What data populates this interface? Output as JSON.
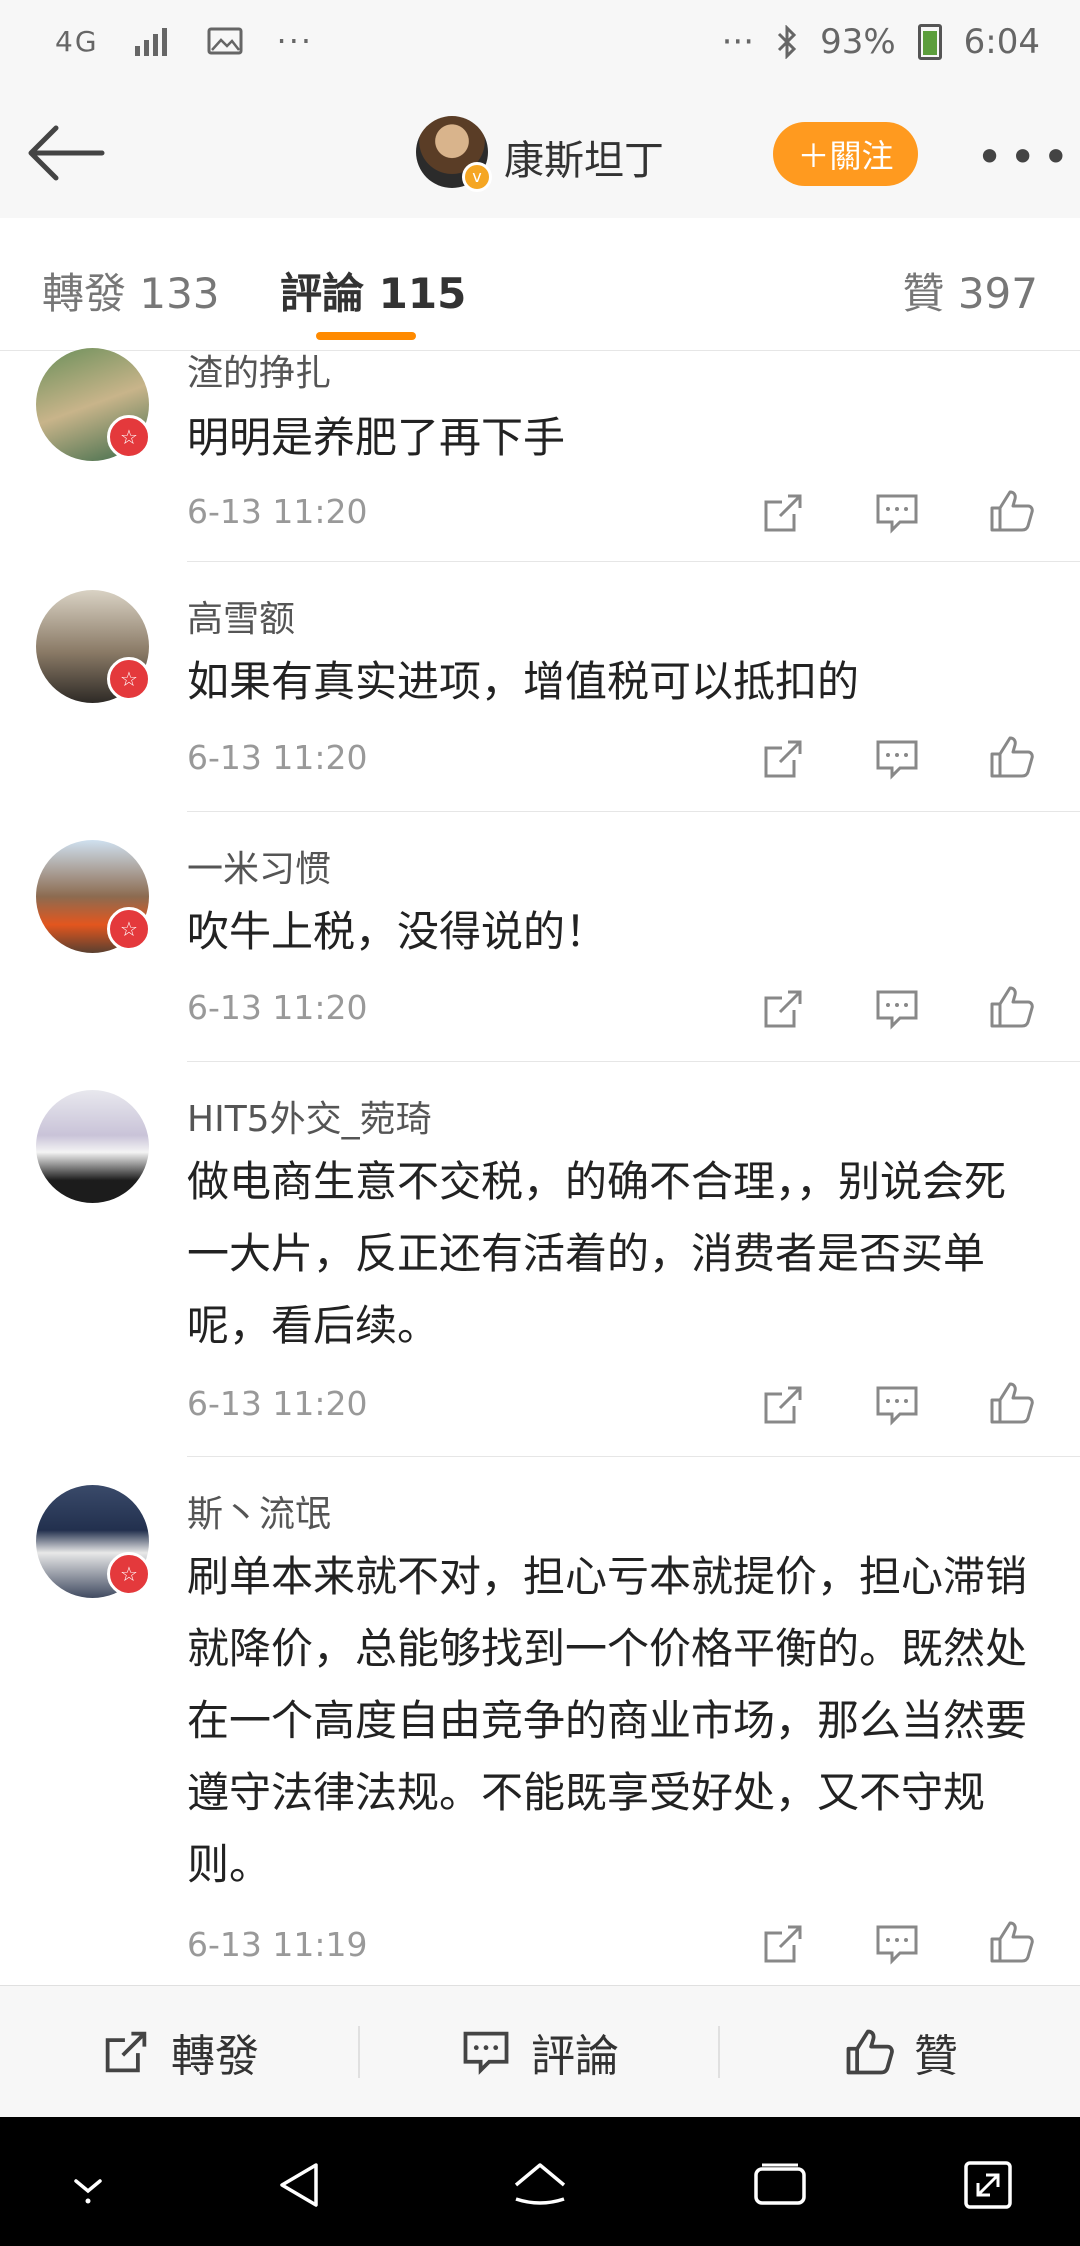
{
  "status_bar": {
    "network": "4G",
    "signal_icon": "signal-bars-icon",
    "image_icon": "gallery-icon",
    "more_left": "···",
    "more_right": "···",
    "bluetooth_icon": "bluetooth-icon",
    "battery": "93%",
    "time": "6:04"
  },
  "header": {
    "username": "康斯坦丁",
    "follow_label": "＋關注",
    "more_icon": "more-dots-icon"
  },
  "tabs": {
    "forward": "轉發 133",
    "comments": "評論 115",
    "likes": "贊 397"
  },
  "comments": [
    {
      "name": "渣的挣扎",
      "text": "明明是养肥了再下手",
      "time": "6-13 11:20"
    },
    {
      "name": "高雪额",
      "text": "如果有真实进项，增值税可以抵扣的",
      "time": "6-13 11:20"
    },
    {
      "name": "一米习惯",
      "text": "吹牛上税，没得说的！",
      "time": "6-13 11:20"
    },
    {
      "name": "HIT5外交_菀琦",
      "text": "做电商生意不交税，的确不合理，，别说会死一大片，反正还有活着的，消费者是否买单呢，看后续。",
      "time": "6-13 11:20"
    },
    {
      "name": "斯丶流氓",
      "text": "刷单本来就不对，担心亏本就提价，担心滞销就降价，总能够找到一个价格平衡的。既然处在一个高度自由竞争的商业市场，那么当然要遵守法律法规。不能既享受好处，又不守规则。",
      "time": "6-13 11:19"
    }
  ],
  "bottom_bar": {
    "forward": "轉發",
    "comment": "評論",
    "like": "贊"
  },
  "colors": {
    "accent": "#ff8a00",
    "follow_button": "#ff9a1f",
    "badge": "#e4393c"
  }
}
